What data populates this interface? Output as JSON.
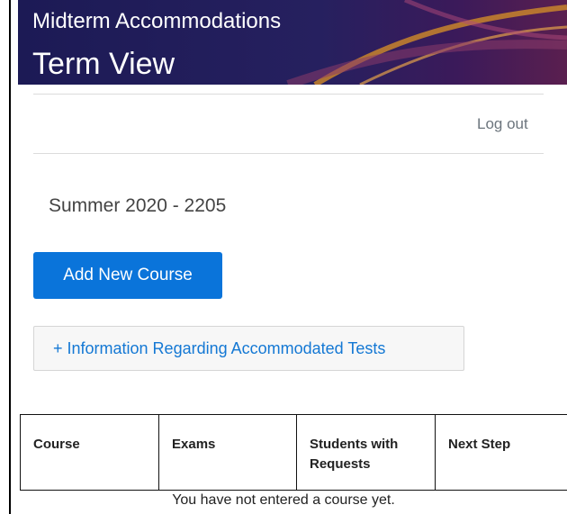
{
  "header": {
    "subtitle": "Midterm Accommodations",
    "title": "Term View"
  },
  "nav": {
    "logout_label": "Log out"
  },
  "term": {
    "label": "Summer 2020 - 2205"
  },
  "actions": {
    "add_course_label": "Add New Course",
    "info_label": "+ Information Regarding Accommodated Tests"
  },
  "table": {
    "columns": [
      "Course",
      "Exams",
      "Students with Requests",
      "Next Step"
    ],
    "empty_message": "You have not entered a course yet."
  },
  "colors": {
    "banner": "#26205f",
    "primary_button": "#0a74da",
    "link": "#1478d4"
  }
}
